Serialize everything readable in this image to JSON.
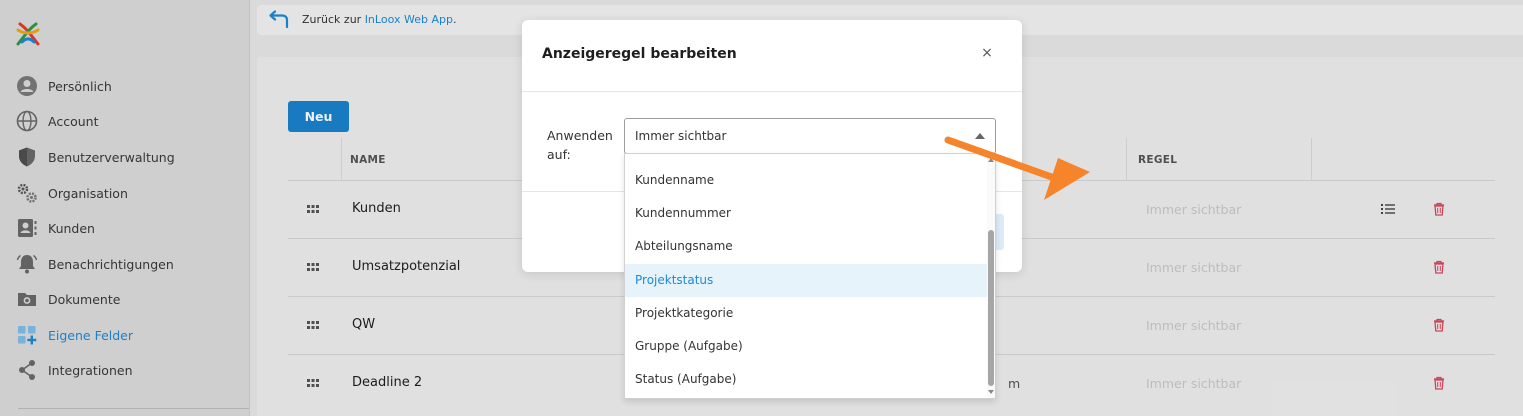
{
  "sidebar": {
    "items": [
      {
        "label": "Persönlich"
      },
      {
        "label": "Account"
      },
      {
        "label": "Benutzerverwaltung"
      },
      {
        "label": "Organisation"
      },
      {
        "label": "Kunden"
      },
      {
        "label": "Benachrichtigungen"
      },
      {
        "label": "Dokumente"
      },
      {
        "label": "Eigene Felder"
      },
      {
        "label": "Integrationen"
      }
    ],
    "active": "Eigene Felder"
  },
  "backbar": {
    "prefix": "Zurück zur ",
    "link": "InLoox Web App",
    "suffix": "."
  },
  "main": {
    "new_button": "Neu",
    "columns": {
      "name": "NAME",
      "rule": "REGEL"
    },
    "rows": [
      {
        "name": "Kunden",
        "rule": "Immer sichtbar",
        "extra": ""
      },
      {
        "name": "Umsatzpotenzial",
        "rule": "Immer sichtbar",
        "extra": ""
      },
      {
        "name": "QW",
        "rule": "Immer sichtbar",
        "extra": ""
      },
      {
        "name": "Deadline 2",
        "rule": "Immer sichtbar",
        "extra": "m"
      }
    ]
  },
  "modal": {
    "title": "Anzeigeregel bearbeiten",
    "close": "×",
    "field_label": "Anwenden auf:",
    "select_value": "Immer sichtbar",
    "options": [
      "Kundenname",
      "Kundennummer",
      "Abteilungsname",
      "Projektstatus",
      "Projektkategorie",
      "Gruppe (Aufgabe)",
      "Status (Aufgabe)"
    ],
    "highlighted_option": "Projektstatus"
  },
  "colors": {
    "accent": "#1d8ad6",
    "button_primary": "#1a82cc",
    "annotation_arrow": "#f5842a",
    "delete_icon": "#d9485f"
  }
}
